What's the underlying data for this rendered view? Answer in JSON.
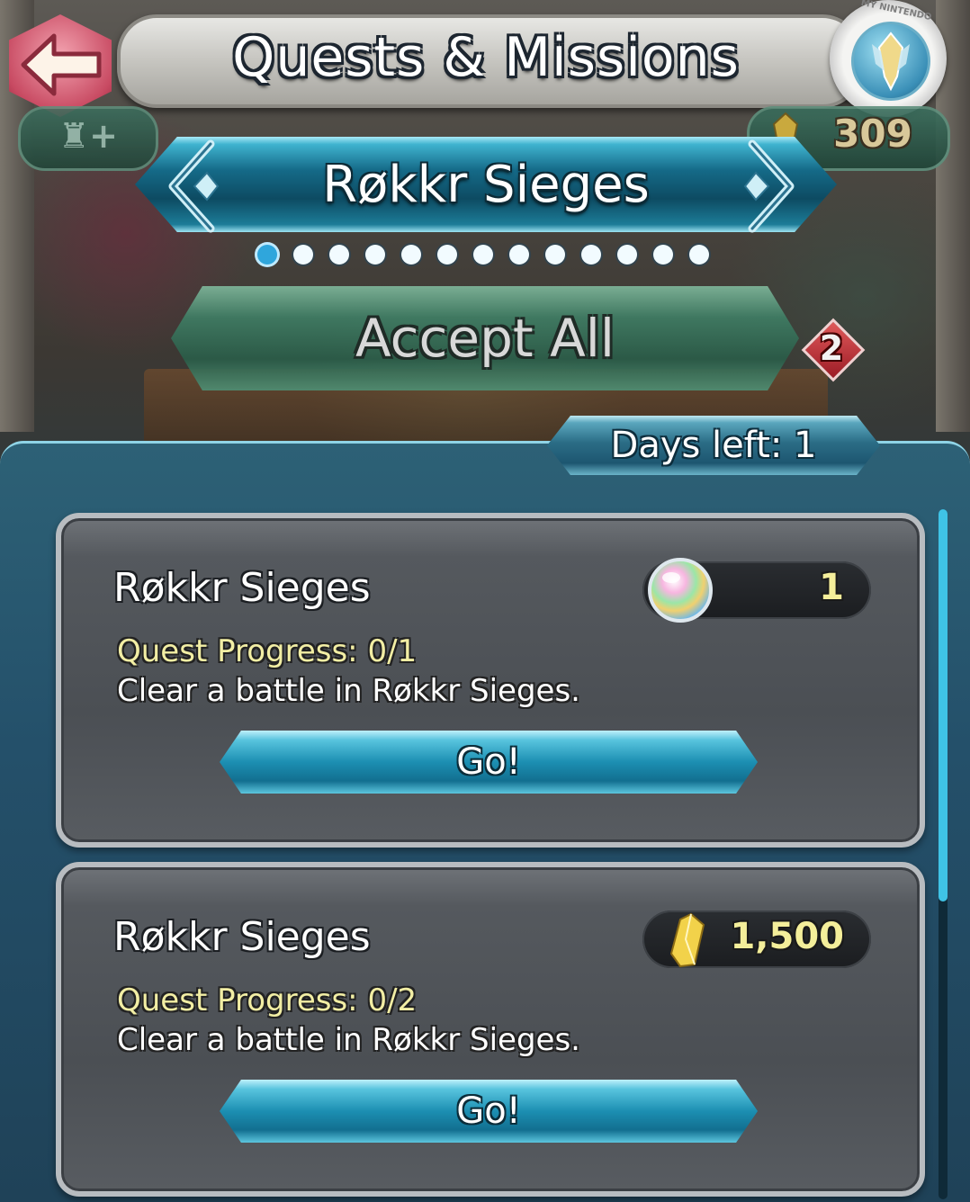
{
  "header": {
    "title": "Quests & Missions",
    "back_icon": "back-arrow-icon",
    "badge_icon": "my-nintendo-badge-icon",
    "badge_ring_text": "MY NINTENDO",
    "orb_count": "309"
  },
  "category": {
    "label": "Røkkr Sieges",
    "page_count": 13,
    "active_page_index": 0
  },
  "accept_all": {
    "label": "Accept All",
    "claimable_count": "2"
  },
  "days_left": "Days left: 1",
  "quests": [
    {
      "title": "Røkkr Sieges",
      "reward_icon": "divine-dew-orb-icon",
      "reward_value": "1",
      "progress": "Quest Progress: 0/1",
      "description": "Clear a battle in Røkkr Sieges.",
      "go_label": "Go!"
    },
    {
      "title": "Røkkr Sieges",
      "reward_icon": "feather-crystal-icon",
      "reward_value": "1,500",
      "progress": "Quest Progress: 0/2",
      "description": "Clear a battle in Røkkr Sieges.",
      "go_label": "Go!"
    }
  ],
  "colors": {
    "accent_blue": "#1c8fb2",
    "progress_yellow": "#f2eea4",
    "panel_bg": "#24506a"
  }
}
